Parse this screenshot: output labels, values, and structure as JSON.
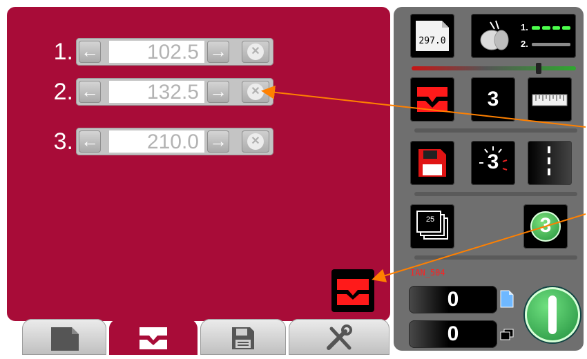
{
  "main": {
    "rows": [
      {
        "num": "1.",
        "value": "102.5"
      },
      {
        "num": "2.",
        "value": "132.5"
      },
      {
        "num": "3.",
        "value": "210.0"
      }
    ],
    "left_arrow": "←",
    "right_arrow": "→",
    "clear_glyph": "✕"
  },
  "right": {
    "paper_size": "297.0",
    "rollers_labels": [
      "1.",
      "2."
    ],
    "cut_count": "3",
    "count_3_tile": "3",
    "stack_label": "25",
    "green_badge": "3",
    "machine_id": "IAN_504",
    "counter_top": "0",
    "counter_bottom": "0"
  },
  "icons": {
    "tabs": [
      "document-icon",
      "cut-mark-icon",
      "floppy-disk-icon",
      "tools-icon"
    ],
    "accent": "#a80c38",
    "annotation_color": "#ff8000"
  }
}
